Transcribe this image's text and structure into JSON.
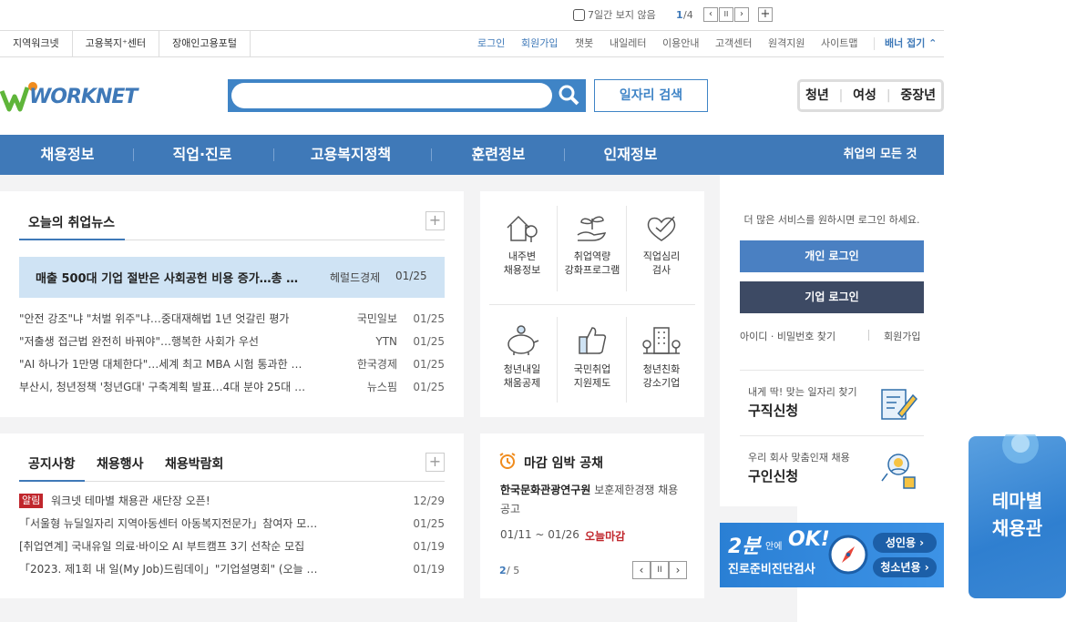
{
  "banner": {
    "checkbox_label": "7일간 보지 않음",
    "page_current": "1",
    "page_total": "/4",
    "prev": "‹",
    "pause": "II",
    "next": "›",
    "add": "+"
  },
  "utility": {
    "sites": [
      "지역워크넷",
      "고용복지⁺센터",
      "장애인고용포털"
    ],
    "login": "로그인",
    "signup": "회원가입",
    "links": [
      "챗봇",
      "내일레터",
      "이용안내",
      "고객센터",
      "원격지원",
      "사이트맵"
    ],
    "banner_fold": "배너 접기"
  },
  "header": {
    "logo_text": "WORKNET",
    "search_placeholder": "",
    "job_search": "일자리 검색",
    "age_groups": [
      "청년",
      "여성",
      "중장년"
    ]
  },
  "gnb": {
    "items": [
      "채용정보",
      "직업·진로",
      "고용복지정책",
      "훈련정보",
      "인재정보"
    ],
    "all": "취업의 모든 것"
  },
  "news": {
    "title": "오늘의 취업뉴스",
    "more": "+",
    "highlight": {
      "title": "매출 500대 기업 절반은 사회공헌 비용 증가…총 …",
      "source": "헤럴드경제",
      "date": "01/25"
    },
    "items": [
      {
        "title": "\"안전 강조\"냐 \"처벌 위주\"냐…중대재해법 1년 엇갈린 평가",
        "source": "국민일보",
        "date": "01/25"
      },
      {
        "title": "\"저출생 접근법 완전히 바꿔야\"…행복한 사회가 우선",
        "source": "YTN",
        "date": "01/25"
      },
      {
        "title": "\"AI 하나가 1만명 대체한다\"…세계 최고 MBA 시험 통과한 …",
        "source": "한국경제",
        "date": "01/25"
      },
      {
        "title": "부산시, 청년정책 '청년G대' 구축계획 발표…4대 분야 25대 …",
        "source": "뉴스핌",
        "date": "01/25"
      }
    ]
  },
  "services": [
    {
      "line1": "내주변",
      "line2": "채용정보",
      "icon": "house-location-icon"
    },
    {
      "line1": "취업역량",
      "line2": "강화프로그램",
      "icon": "sprout-hand-icon"
    },
    {
      "line1": "직업심리",
      "line2": "검사",
      "icon": "heart-check-icon"
    },
    {
      "line1": "청년내일",
      "line2": "채움공제",
      "icon": "piggy-bank-icon"
    },
    {
      "line1": "국민취업",
      "line2": "지원제도",
      "icon": "thumbs-up-icon"
    },
    {
      "line1": "청년친화",
      "line2": "강소기업",
      "icon": "building-icon"
    }
  ],
  "notice": {
    "tabs": [
      "공지사항",
      "채용행사",
      "채용박람회"
    ],
    "more": "+",
    "badge": "알림",
    "items": [
      {
        "title": "워크넷 테마별 채용관 새단장 오픈!",
        "date": "12/29"
      },
      {
        "title": "「서울형 뉴딜일자리 지역아동센터 아동복지전문가」참여자 모…",
        "date": "01/25"
      },
      {
        "title": "[취업연계] 국내유일 의료·바이오 AI 부트캠프 3기 선착순 모집",
        "date": "01/19"
      },
      {
        "title": "「2023. 제1회 내 일(My Job)드림데이」\"기업설명회\" (오늘 …",
        "date": "01/19"
      }
    ]
  },
  "deadline": {
    "title": "마감 임박 공채",
    "org": "한국문화관광연구원",
    "desc": "보훈제한경쟁 채용 공고",
    "period": "01/11 ~ 01/26",
    "status": "오늘마감",
    "page_current": "2",
    "page_total": " / 5",
    "prev": "‹",
    "pause": "II",
    "next": "›"
  },
  "login_panel": {
    "message": "더 많은 서비스를 원하시면 로그인 하세요.",
    "personal": "개인 로그인",
    "company": "기업 로그인",
    "find": "아이디 · 비밀번호 찾기",
    "signup": "회원가입",
    "job_apply_sub": "내게 딱! 맞는 일자리 찾기",
    "job_apply": "구직신청",
    "talent_sub": "우리 회사 맞춤인재 채용",
    "talent": "구인신청"
  },
  "promo": {
    "big": "2분",
    "small": "안에",
    "ok": "OK!",
    "name": "진로준비진단검사",
    "adult": "성인용",
    "youth": "청소년용"
  },
  "theme": {
    "line1": "테마별",
    "line2": "채용관"
  },
  "colors": {
    "brand_blue": "#3f79b8",
    "search_blue": "#3f84c6",
    "highlight_bg": "#cfe3f4",
    "deadline_red": "#c0262c",
    "logo_green": "#5fb53a"
  }
}
